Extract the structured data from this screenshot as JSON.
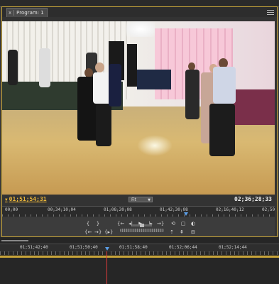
{
  "panel": {
    "tab_label": "Program: 1",
    "tab_close": "x"
  },
  "monitor": {
    "playhead_timecode": "01;51;54;31",
    "zoom_select": "Fit",
    "duration_timecode": "02;36;28;33",
    "ruler_labels": [
      "00;00",
      "00;34;10;04",
      "01;08;20;08",
      "01;42;30;08",
      "02;16;40;12",
      "02;50"
    ]
  },
  "transport": {
    "mark_in": "{",
    "mark_out": "}",
    "goto_in": "{←",
    "step_back": "◂|",
    "play": "▶",
    "step_forward": "|▸",
    "goto_out": "→}",
    "loop": "⟲",
    "safe_margins": "▢",
    "output": "◐",
    "clip_in": "{←",
    "clip_out": "→}",
    "play_in_to_out": "{▸}",
    "insert": "⇥",
    "overwrite": "⇉",
    "lift": "⇡",
    "extract": "⇞",
    "trim": "⊟"
  },
  "sequence": {
    "ruler_labels": [
      "01;51;42;40",
      "01;51;50;40",
      "01;51;58;40",
      "01;52;06;44",
      "01;52;14;44"
    ]
  },
  "colors": {
    "accent_timecode": "#e8b43a",
    "playhead": "#5b9ee6",
    "playline": "#d93a3a",
    "workarea": "#c9a53a"
  },
  "icons": [
    "panel-menu-icon",
    "playhead-marker-icon"
  ]
}
